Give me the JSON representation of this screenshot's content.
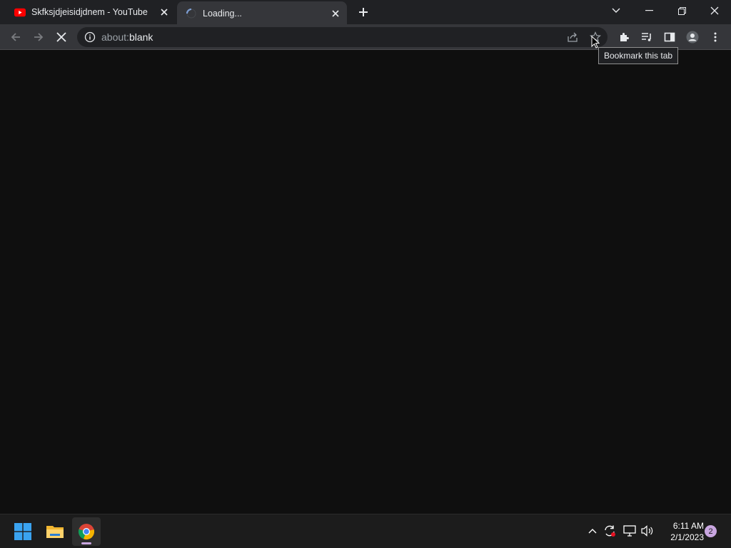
{
  "tabs": [
    {
      "title": "Skfksjdjeisidjdnem - YouTube",
      "favicon": "youtube-icon",
      "active": false
    },
    {
      "title": "Loading...",
      "favicon": "loading-spinner-icon",
      "active": true
    }
  ],
  "address_bar": {
    "scheme": "about:",
    "host": "blank"
  },
  "tooltip": {
    "text": "Bookmark this tab"
  },
  "toolbar_icons": [
    "back-icon",
    "forward-icon",
    "stop-icon",
    "share-icon",
    "star-icon",
    "extensions-icon",
    "media-queue-icon",
    "side-panel-icon",
    "profile-icon",
    "menu-icon"
  ],
  "taskbar": {
    "apps": [
      "windows-start-icon",
      "file-explorer-icon",
      "chrome-icon"
    ],
    "clock_time": "6:11 AM",
    "clock_date": "2/1/2023",
    "notification_count": "2"
  },
  "colors": {
    "background": "#0f0f0f",
    "tab_strip": "#202124",
    "toolbar": "#35363a",
    "youtube_red": "#ff0000",
    "accent": "#c9a6e0"
  }
}
